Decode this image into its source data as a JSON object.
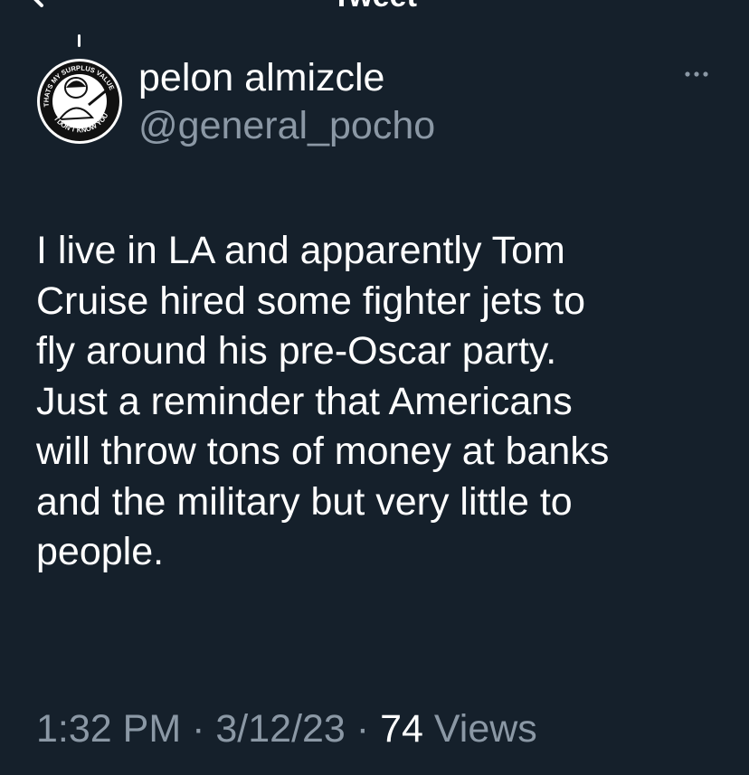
{
  "header": {
    "title": "Tweet"
  },
  "avatar": {
    "ring_text_top": "THATS MY SURPLUS VALUE",
    "ring_text_bottom": "I DON'T KNOW YOU"
  },
  "tweet": {
    "display_name": "pelon almizcle",
    "handle": "@general_pocho",
    "text_lines": [
      "I live in LA and apparently Tom",
      "Cruise hired some fighter jets to",
      "fly around his pre-Oscar party.",
      "Just a reminder that Americans",
      "will throw tons of money at banks",
      "and the military but very little to",
      "people."
    ],
    "time": "1:32 PM",
    "date": "3/12/23",
    "views_count": "74",
    "views_label": "Views",
    "separator": "·"
  },
  "colors": {
    "background": "#15202b",
    "primary_text": "#ffffff",
    "secondary_text": "#8b98a5"
  },
  "icons": {
    "back": "back-arrow-icon",
    "more": "more-horizontal-icon"
  }
}
